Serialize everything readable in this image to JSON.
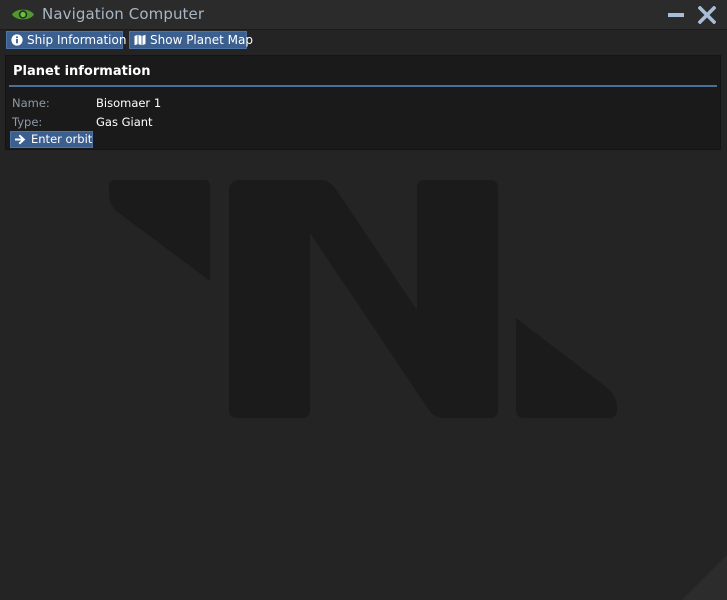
{
  "window": {
    "title": "Navigation Computer",
    "icon": "eye-icon",
    "controls": {
      "minimize_icon": "minimize-icon",
      "close_icon": "close-icon"
    }
  },
  "toolbar": {
    "ship_info_label": "Ship Information",
    "ship_info_icon": "info-icon",
    "planet_map_label": "Show Planet Map",
    "planet_map_icon": "map-icon"
  },
  "planet": {
    "heading": "Planet information",
    "name_label": "Name:",
    "name_value": "Bisomaer 1",
    "type_label": "Type:",
    "type_value": "Gas Giant",
    "enter_orbit_label": "Enter orbit",
    "enter_orbit_icon": "arrow-right-icon"
  },
  "colors": {
    "background": "#242424",
    "panel": "#1a1a1a",
    "accent_button": "#3b5f8e",
    "title_text": "#a8b6c4",
    "eye_icon": "#5fa83a",
    "rule": "#4b6f98"
  }
}
